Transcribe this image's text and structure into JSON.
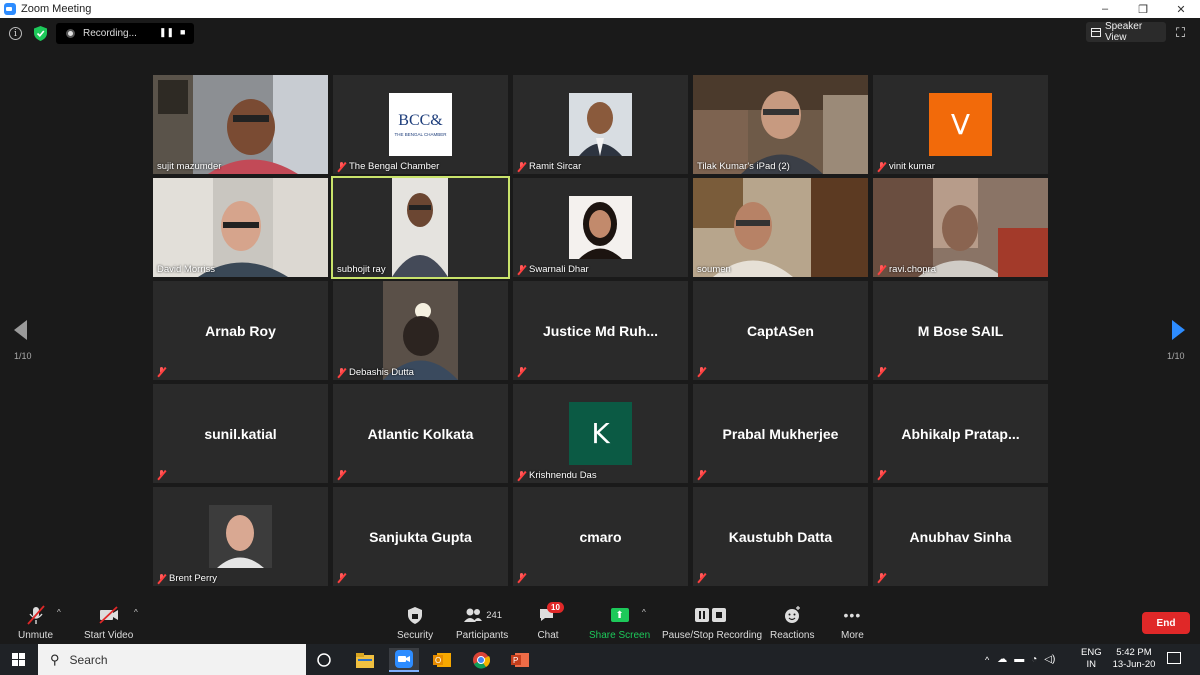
{
  "window": {
    "title": "Zoom Meeting",
    "controls": [
      "–",
      "❐",
      "✕"
    ]
  },
  "topbar": {
    "recording_label": "Recording...",
    "speaker_view_label": "Speaker View"
  },
  "pagination": {
    "left": "1/10",
    "right": "1/10"
  },
  "tiles": [
    {
      "name": "sujit mazumder",
      "kind": "video"
    },
    {
      "name": "The Bengal Chamber",
      "kind": "image",
      "logo_text": "BCC&",
      "logo_sub": "THE BENGAL CHAMBER"
    },
    {
      "name": "Ramit Sircar",
      "kind": "image"
    },
    {
      "name": "Tilak Kumar's iPad (2)",
      "kind": "video"
    },
    {
      "name": "vinit kumar",
      "kind": "letter",
      "letter": "V",
      "color": "#f26a0a"
    },
    {
      "name": "David Morriss",
      "kind": "video"
    },
    {
      "name": "subhojit ray",
      "kind": "video",
      "active": true
    },
    {
      "name": "Swarnali Dhar",
      "kind": "image"
    },
    {
      "name": "soumen",
      "kind": "video"
    },
    {
      "name": "ravi.chopra",
      "kind": "video"
    },
    {
      "name": "Arnab Roy",
      "kind": "text"
    },
    {
      "name": "Debashis Dutta",
      "kind": "video"
    },
    {
      "name": "Justice  Md  Ruh...",
      "kind": "text"
    },
    {
      "name": "CaptASen",
      "kind": "text"
    },
    {
      "name": "M Bose SAIL",
      "kind": "text"
    },
    {
      "name": "sunil.katial",
      "kind": "text"
    },
    {
      "name": "Atlantic Kolkata",
      "kind": "text"
    },
    {
      "name": "Krishnendu Das",
      "kind": "letter",
      "letter": "K",
      "color": "#0b5a44"
    },
    {
      "name": "Prabal Mukherjee",
      "kind": "text"
    },
    {
      "name": "Abhikalp  Pratap...",
      "kind": "text"
    },
    {
      "name": "Brent Perry",
      "kind": "image"
    },
    {
      "name": "Sanjukta Gupta",
      "kind": "text"
    },
    {
      "name": "cmaro",
      "kind": "text"
    },
    {
      "name": "Kaustubh Datta",
      "kind": "text"
    },
    {
      "name": "Anubhav Sinha",
      "kind": "text"
    }
  ],
  "toolbar": {
    "unmute": "Unmute",
    "start_video": "Start Video",
    "security": "Security",
    "participants": "Participants",
    "participants_count": "241",
    "chat": "Chat",
    "chat_badge": "10",
    "share_screen": "Share Screen",
    "pause_stop_recording": "Pause/Stop Recording",
    "reactions": "Reactions",
    "more": "More",
    "end": "End"
  },
  "taskbar": {
    "search_placeholder": "Search",
    "lang_line1": "ENG",
    "lang_line2": "IN",
    "time": "5:42 PM",
    "date": "13-Jun-20"
  }
}
